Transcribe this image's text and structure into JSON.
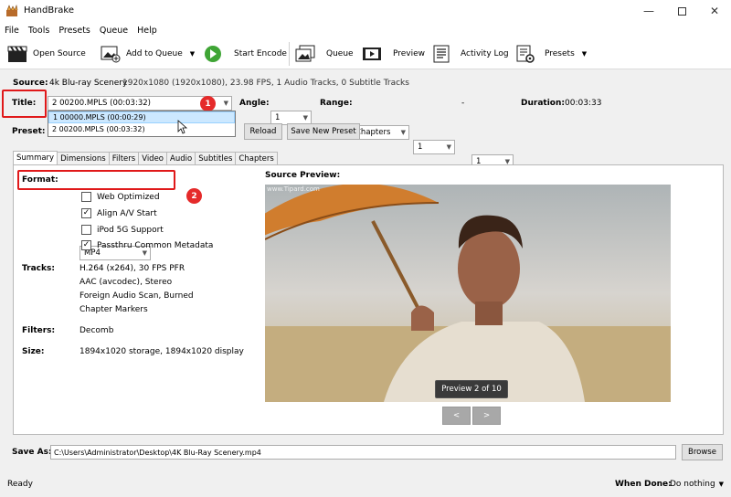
{
  "window": {
    "title": "HandBrake"
  },
  "menu": [
    "File",
    "Tools",
    "Presets",
    "Queue",
    "Help"
  ],
  "toolbar": {
    "open_source": "Open Source",
    "add_to_queue": "Add to Queue",
    "start_encode": "Start Encode",
    "queue": "Queue",
    "preview": "Preview",
    "activity_log": "Activity Log",
    "presets": "Presets"
  },
  "source": {
    "label": "Source:",
    "name": "4k Blu-ray Scenery",
    "info": "1920x1080 (1920x1080), 23.98 FPS, 1 Audio Tracks, 0 Subtitle Tracks"
  },
  "title": {
    "label": "Title:",
    "value": "2  00200.MPLS (00:03:32)",
    "options": [
      "1  00000.MPLS (00:00:29)",
      "2  00200.MPLS (00:03:32)"
    ]
  },
  "angle": {
    "label": "Angle:",
    "value": "1"
  },
  "range": {
    "label": "Range:",
    "mode": "Chapters",
    "from": "1",
    "dash": "-",
    "to": "1"
  },
  "duration": {
    "label": "Duration:",
    "value": "00:03:33"
  },
  "preset": {
    "label": "Preset:",
    "reload": "Reload",
    "save_new": "Save New Preset"
  },
  "annotations": {
    "one": "1",
    "two": "2"
  },
  "tabs": [
    "Summary",
    "Dimensions",
    "Filters",
    "Video",
    "Audio",
    "Subtitles",
    "Chapters"
  ],
  "summary": {
    "format_label": "Format:",
    "format_value": "MP4",
    "options": [
      {
        "label": "Web Optimized",
        "checked": false
      },
      {
        "label": "Align A/V Start",
        "checked": true
      },
      {
        "label": "iPod 5G Support",
        "checked": false
      },
      {
        "label": "Passthru Common Metadata",
        "checked": true
      }
    ],
    "tracks_label": "Tracks:",
    "tracks": [
      "H.264 (x264), 30 FPS PFR",
      "AAC (avcodec), Stereo",
      "Foreign Audio Scan, Burned",
      "Chapter Markers"
    ],
    "filters_label": "Filters:",
    "filters_value": "Decomb",
    "size_label": "Size:",
    "size_value": "1894x1020 storage, 1894x1020 display"
  },
  "source_preview": {
    "label": "Source Preview:",
    "watermark": "www.Tipard.com",
    "badge": "Preview 2 of 10",
    "prev": "<",
    "next": ">"
  },
  "save_as": {
    "label": "Save As:",
    "path": "C:\\Users\\Administrator\\Desktop\\4K Blu-Ray Scenery.mp4",
    "browse": "Browse"
  },
  "status": {
    "ready": "Ready",
    "when_done_label": "When Done:",
    "when_done_value": "Do nothing"
  }
}
